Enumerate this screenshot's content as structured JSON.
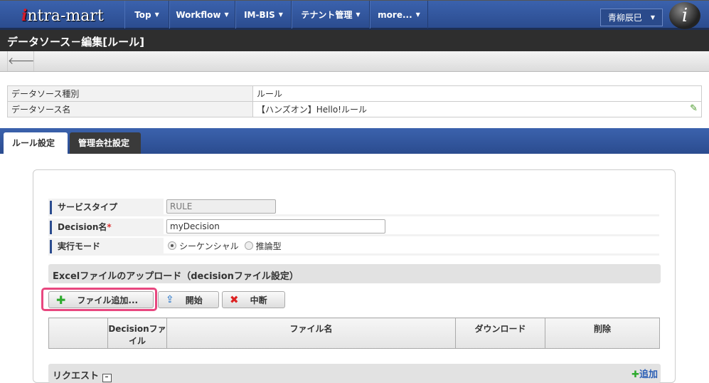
{
  "header": {
    "logo": "intra-mart",
    "menus": [
      "Top",
      "Workflow",
      "IM-BIS",
      "テナント管理",
      "more..."
    ],
    "user": "青柳辰巳"
  },
  "page_title": "データソース－編集[ルール]",
  "info": {
    "rows": [
      {
        "label": "データソース種別",
        "value": "ルール"
      },
      {
        "label": "データソース名",
        "value": "【ハンズオン】Hello!ルール"
      }
    ]
  },
  "tabs": [
    "ルール設定",
    "管理会社設定"
  ],
  "form": {
    "service_type_label": "サービスタイプ",
    "service_type_value": "RULE",
    "decision_label": "Decision名",
    "required_mark": "*",
    "decision_value": "myDecision",
    "mode_label": "実行モード",
    "mode_options": [
      "シーケンシャル",
      "推論型"
    ],
    "mode_selected": "シーケンシャル"
  },
  "upload": {
    "section_title": "Excelファイルのアップロード（decisionファイル設定）",
    "add_button": "ファイル追加...",
    "start_button": "開始",
    "stop_button": "中断",
    "columns": [
      "",
      "Decisionファイル",
      "ファイル名",
      "ダウンロード",
      "削除"
    ]
  },
  "request": {
    "title": "リクエスト",
    "add": "追加"
  }
}
